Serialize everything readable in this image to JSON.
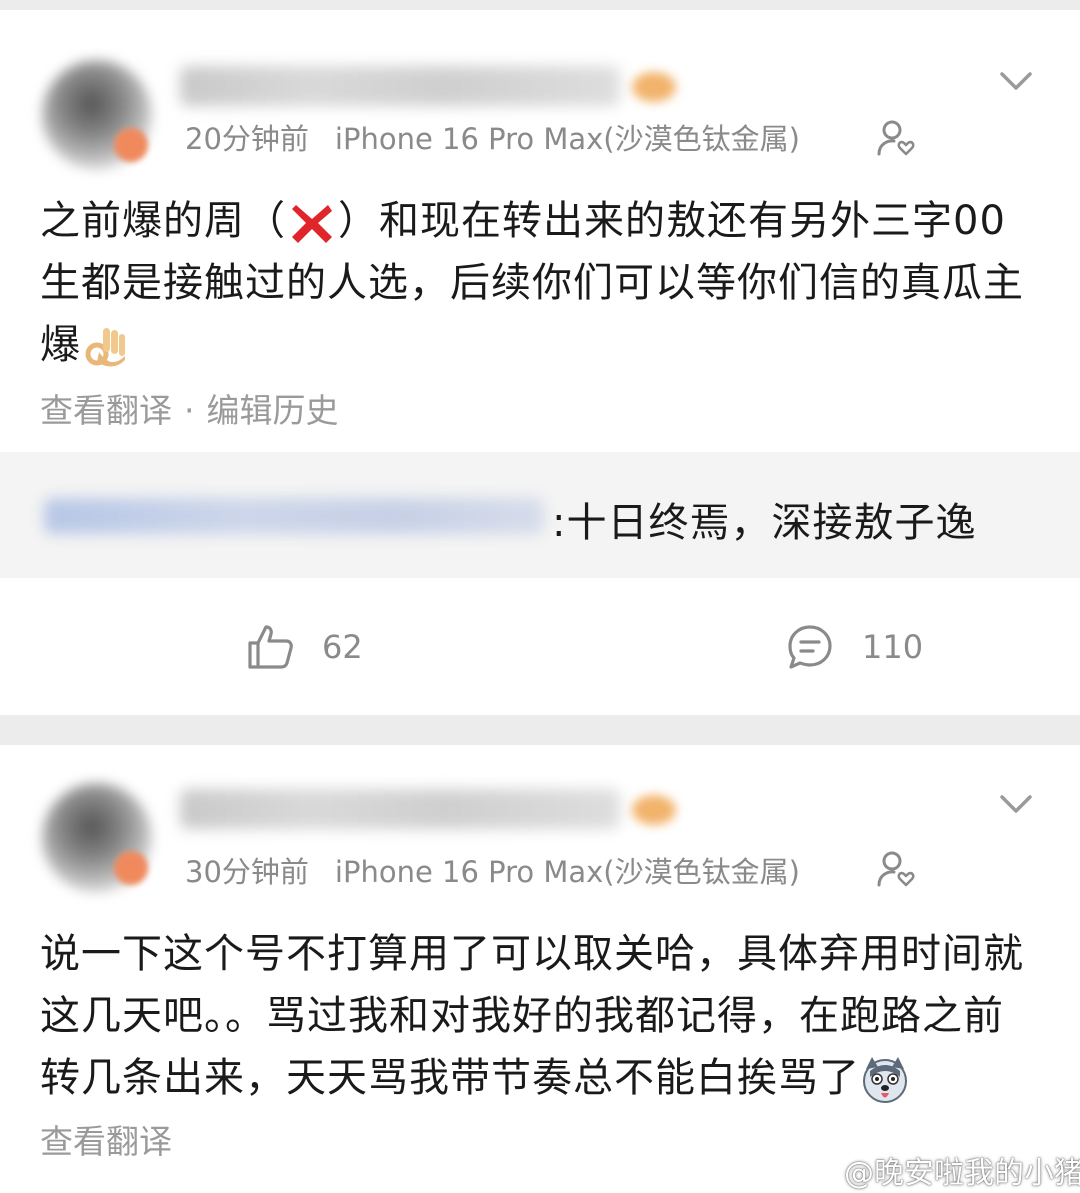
{
  "posts": [
    {
      "time": "20分钟前",
      "device": "iPhone 16 Pro Max(沙漠色钛金属)",
      "text_before_icon": "之前爆的周（",
      "text_after_icon": "）和现在转出来的敖还有另外三字00生都是接触过的人选，后续你们可以等你们信的真瓜主爆",
      "icon": "red-cross-icon",
      "trailing_emoji": "ok-hand-emoji",
      "link_translate": "查看翻译",
      "link_separator": "·",
      "link_history": "编辑历史",
      "quote_text": ":十日终焉，深接敖子逸",
      "likes": "62",
      "comments": "110"
    },
    {
      "time": "30分钟前",
      "device": "iPhone 16 Pro Max(沙漠色钛金属)",
      "text": "说一下这个号不打算用了可以取关哈，具体弃用时间就这几天吧。。骂过我和对我好的我都记得，在跑路之前转几条出来，天天骂我带节奏总不能白挨骂了",
      "trailing_emoji": "husky-emoji",
      "link_translate": "查看翻译"
    }
  ],
  "watermark": "@晚安啦我的小猪",
  "colors": {
    "meta_gray": "#8a8a8a",
    "link_gray": "#9a9a9a",
    "quote_bg": "#f4f4f4",
    "page_bg": "#ececec",
    "cross_red": "#e0262b"
  }
}
